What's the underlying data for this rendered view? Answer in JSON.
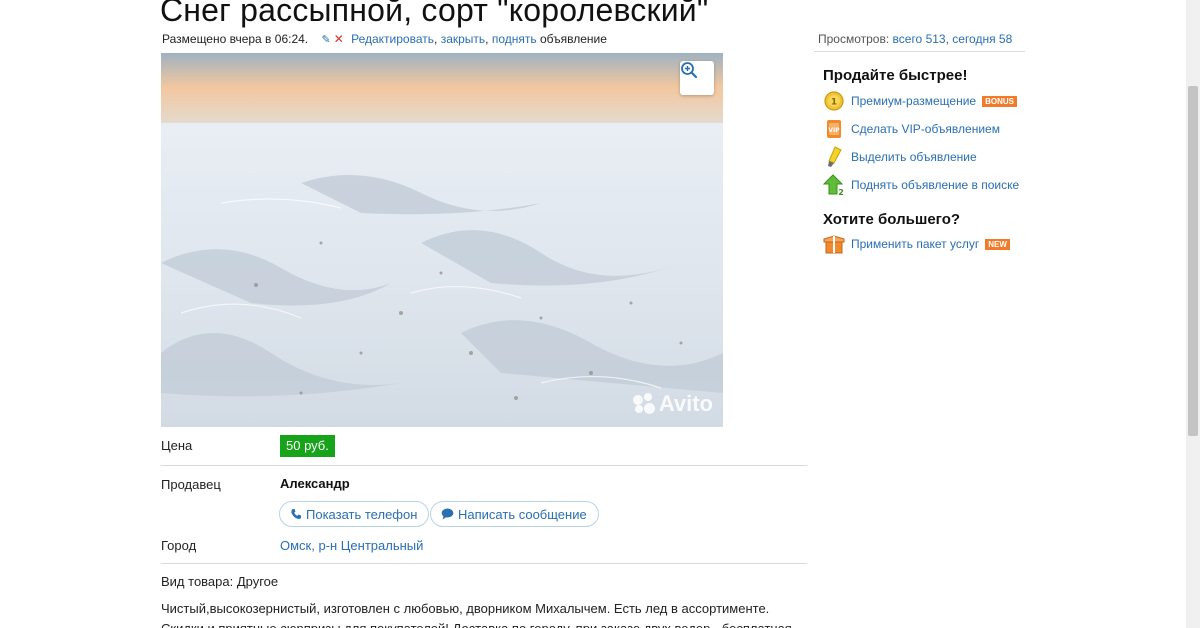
{
  "listing": {
    "title": "Снег рассыпной, сорт \"королевский\"",
    "posted": "Размещено вчера в 06:24.",
    "actions": {
      "edit": "Редактировать",
      "sep1": ", ",
      "close": "закрыть",
      "sep2": ", ",
      "raise": "поднять",
      "suffix": " объявление"
    }
  },
  "views": {
    "label": "Просмотров: ",
    "total": "всего 513",
    "sep": ", ",
    "today": "сегодня 58"
  },
  "photo": {
    "watermark": "Avito"
  },
  "details": {
    "price_label": "Цена",
    "price": "50 руб.",
    "seller_label": "Продавец",
    "seller_name": "Александр",
    "show_phone": "Показать телефон",
    "write_message": "Написать сообщение",
    "city_label": "Город",
    "city": "Омск, р-н Центральный",
    "goods_type": "Вид товара: Другое",
    "description": "Чистый,высокозернистый, изготовлен с любовью, дворником Михалычем. Есть лед в ассортименте. Скидки и приятные сюрпризы для покупателей! Доставка по городу, при заказе двух ведер - бесплатная. При доставке"
  },
  "sidebar": {
    "sell_faster": "Продайте быстрее!",
    "items": [
      {
        "label": "Премиум-размещение",
        "tag": "BONUS"
      },
      {
        "label": "Сделать VIP-объявлением",
        "tag": ""
      },
      {
        "label": "Выделить объявление",
        "tag": ""
      },
      {
        "label": "Поднять объявление в поиске",
        "tag": ""
      }
    ],
    "want_more": "Хотите большего?",
    "package": {
      "label": "Применить пакет услуг",
      "tag": "NEW"
    }
  },
  "colors": {
    "link": "#2a6fb0",
    "price_bg": "#17a31a",
    "tag_bg": "#f07b2a",
    "delete_red": "#d9342b"
  },
  "icons": {
    "edit": "pencil-icon",
    "delete": "close-icon",
    "zoom": "zoom-in-icon",
    "phone": "phone-icon",
    "message": "speech-bubble-icon",
    "premium": "coin-icon",
    "vip": "vip-badge-icon",
    "highlight": "marker-icon",
    "raise": "arrow-up-icon",
    "package": "gift-box-icon"
  }
}
